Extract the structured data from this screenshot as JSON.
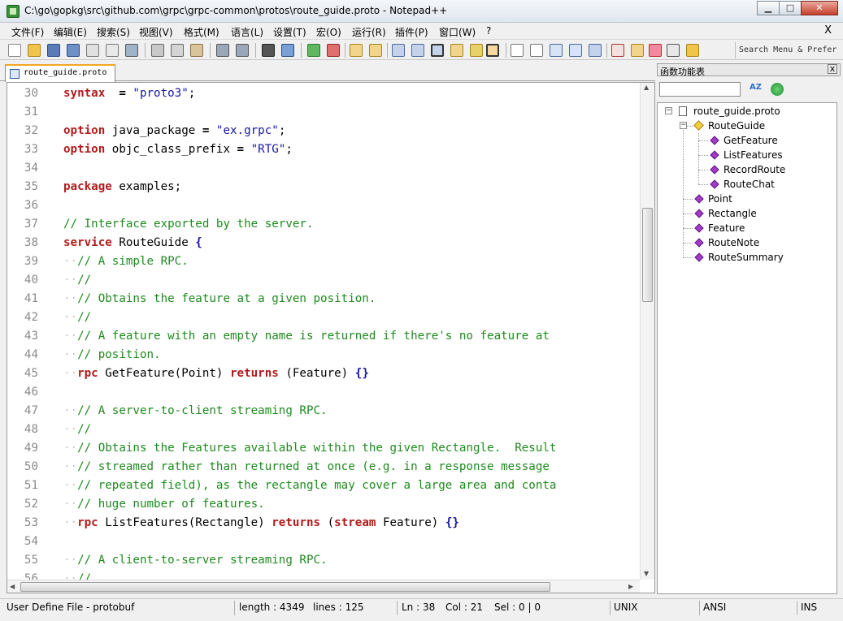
{
  "window": {
    "title": "C:\\go\\gopkg\\src\\github.com\\grpc\\grpc-common\\protos\\route_guide.proto - Notepad++",
    "minimize": "▁",
    "maximize": "□",
    "close": "✕"
  },
  "menu": {
    "items": [
      "文件(F)",
      "编辑(E)",
      "搜索(S)",
      "视图(V)",
      "格式(M)",
      "语言(L)",
      "设置(T)",
      "宏(O)",
      "运行(R)",
      "插件(P)",
      "窗口(W)",
      "?"
    ],
    "close": "X"
  },
  "toolbar": {
    "search_menu": "Search Menu & Prefer"
  },
  "tab": {
    "label": "route_guide.proto"
  },
  "editor": {
    "lines": [
      {
        "n": "30",
        "segs": [
          [
            "kw",
            "syntax"
          ],
          [
            "",
            "  "
          ],
          [
            "op",
            "="
          ],
          [
            "",
            ""
          ],
          [
            "st",
            " \"proto3\""
          ],
          [
            "",
            ";"
          ]
        ]
      },
      {
        "n": "31",
        "segs": []
      },
      {
        "n": "32",
        "segs": [
          [
            "kw",
            "option"
          ],
          [
            "",
            ""
          ],
          [
            "",
            " java_package "
          ],
          [
            "op",
            "="
          ],
          [
            "st",
            " \"ex.grpc\""
          ],
          [
            "",
            ";"
          ]
        ]
      },
      {
        "n": "33",
        "segs": [
          [
            "kw",
            "option"
          ],
          [
            "",
            " objc_class_prefix "
          ],
          [
            "op",
            "="
          ],
          [
            "st",
            " \"RTG\""
          ],
          [
            "",
            ";"
          ]
        ]
      },
      {
        "n": "34",
        "segs": []
      },
      {
        "n": "35",
        "segs": [
          [
            "kw",
            "package"
          ],
          [
            "",
            " examples;"
          ]
        ]
      },
      {
        "n": "36",
        "segs": []
      },
      {
        "n": "37",
        "segs": [
          [
            "cm",
            "// Interface exported by the server."
          ]
        ]
      },
      {
        "n": "38",
        "segs": [
          [
            "kw",
            "service"
          ],
          [
            "",
            " RouteGuide "
          ],
          [
            "br",
            "{"
          ]
        ]
      },
      {
        "n": "39",
        "segs": [
          [
            "ws",
            "··"
          ],
          [
            "cm",
            "// A simple RPC."
          ]
        ]
      },
      {
        "n": "40",
        "segs": [
          [
            "ws",
            "··"
          ],
          [
            "cm",
            "//"
          ]
        ]
      },
      {
        "n": "41",
        "segs": [
          [
            "ws",
            "··"
          ],
          [
            "cm",
            "// Obtains the feature at a given position."
          ]
        ]
      },
      {
        "n": "42",
        "segs": [
          [
            "ws",
            "··"
          ],
          [
            "cm",
            "//"
          ]
        ]
      },
      {
        "n": "43",
        "segs": [
          [
            "ws",
            "··"
          ],
          [
            "cm",
            "// A feature with an empty name is returned if there's no feature at"
          ]
        ]
      },
      {
        "n": "44",
        "segs": [
          [
            "ws",
            "··"
          ],
          [
            "cm",
            "// position."
          ]
        ]
      },
      {
        "n": "45",
        "segs": [
          [
            "ws",
            "··"
          ],
          [
            "kw",
            "rpc"
          ],
          [
            "",
            " GetFeature(Point) "
          ],
          [
            "kw",
            "returns"
          ],
          [
            "",
            " (Feature) "
          ],
          [
            "br",
            "{}"
          ]
        ]
      },
      {
        "n": "46",
        "segs": []
      },
      {
        "n": "47",
        "segs": [
          [
            "ws",
            "··"
          ],
          [
            "cm",
            "// A server-to-client streaming RPC."
          ]
        ]
      },
      {
        "n": "48",
        "segs": [
          [
            "ws",
            "··"
          ],
          [
            "cm",
            "//"
          ]
        ]
      },
      {
        "n": "49",
        "segs": [
          [
            "ws",
            "··"
          ],
          [
            "cm",
            "// Obtains the Features available within the given Rectangle.  Result"
          ]
        ]
      },
      {
        "n": "50",
        "segs": [
          [
            "ws",
            "··"
          ],
          [
            "cm",
            "// streamed rather than returned at once (e.g. in a response message"
          ]
        ]
      },
      {
        "n": "51",
        "segs": [
          [
            "ws",
            "··"
          ],
          [
            "cm",
            "// repeated field), as the rectangle may cover a large area and conta"
          ]
        ]
      },
      {
        "n": "52",
        "segs": [
          [
            "ws",
            "··"
          ],
          [
            "cm",
            "// huge number of features."
          ]
        ]
      },
      {
        "n": "53",
        "segs": [
          [
            "ws",
            "··"
          ],
          [
            "kw",
            "rpc"
          ],
          [
            "",
            " ListFeatures(Rectangle) "
          ],
          [
            "kw",
            "returns"
          ],
          [
            "",
            " ("
          ],
          [
            "kw",
            "stream"
          ],
          [
            "",
            " Feature) "
          ],
          [
            "br",
            "{}"
          ]
        ]
      },
      {
        "n": "54",
        "segs": []
      },
      {
        "n": "55",
        "segs": [
          [
            "ws",
            "··"
          ],
          [
            "cm",
            "// A client-to-server streaming RPC."
          ]
        ]
      },
      {
        "n": "56",
        "segs": [
          [
            "ws",
            "··"
          ],
          [
            "cm",
            "//"
          ]
        ]
      }
    ]
  },
  "function_list": {
    "title": "函数功能表",
    "close": "x",
    "sort_label": "AZ",
    "nodes": [
      {
        "label": "route_guide.proto",
        "level": 0,
        "icon": "file",
        "name": "tree-file-route-guide"
      },
      {
        "label": "RouteGuide",
        "level": 1,
        "icon": "cls",
        "name": "tree-class-routeguide"
      },
      {
        "label": "GetFeature",
        "level": 2,
        "icon": "fn",
        "name": "tree-fn-getfeature"
      },
      {
        "label": "ListFeatures",
        "level": 2,
        "icon": "fn",
        "name": "tree-fn-listfeatures"
      },
      {
        "label": "RecordRoute",
        "level": 2,
        "icon": "fn",
        "name": "tree-fn-recordroute"
      },
      {
        "label": "RouteChat",
        "level": 2,
        "icon": "fn",
        "name": "tree-fn-routechat"
      },
      {
        "label": "Point",
        "level": 1,
        "icon": "fn",
        "name": "tree-fn-point"
      },
      {
        "label": "Rectangle",
        "level": 1,
        "icon": "fn",
        "name": "tree-fn-rectangle"
      },
      {
        "label": "Feature",
        "level": 1,
        "icon": "fn",
        "name": "tree-fn-feature"
      },
      {
        "label": "RouteNote",
        "level": 1,
        "icon": "fn",
        "name": "tree-fn-routenote"
      },
      {
        "label": "RouteSummary",
        "level": 1,
        "icon": "fn",
        "name": "tree-fn-routesummary"
      }
    ]
  },
  "status": {
    "filetype": "User Define File - protobuf",
    "length": "length : 4349",
    "lines": "lines : 125",
    "ln": "Ln : 38",
    "col": "Col : 21",
    "sel": "Sel : 0 | 0",
    "eol": "UNIX",
    "encoding": "ANSI",
    "mode": "INS"
  }
}
